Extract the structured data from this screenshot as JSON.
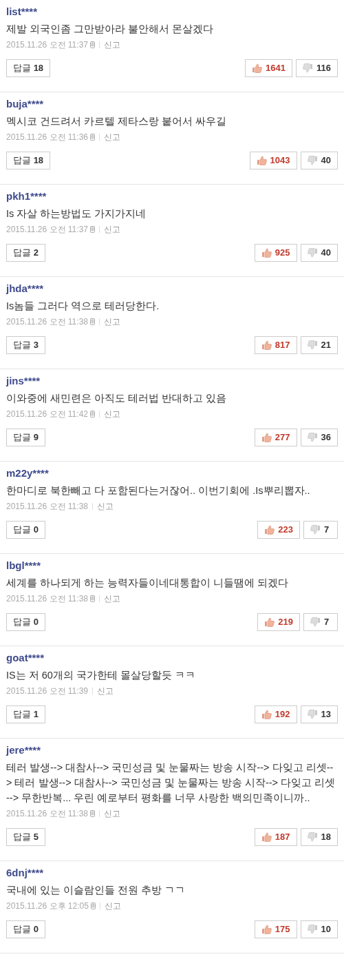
{
  "comments": [
    {
      "user": "list****",
      "text": "제발 외국인좀 그만받아라 불안해서 몬살겠다",
      "date": "2015.11.26 오전 11:37",
      "mobile": true,
      "report": "신고",
      "reply_label": "답글",
      "replies": "18",
      "likes": "1641",
      "dislikes": "116"
    },
    {
      "user": "buja****",
      "text": "멕시코 건드려서 카르텔 제타스랑 붙어서 싸우길",
      "date": "2015.11.26 오전 11:36",
      "mobile": true,
      "report": "신고",
      "reply_label": "답글",
      "replies": "18",
      "likes": "1043",
      "dislikes": "40"
    },
    {
      "user": "pkh1****",
      "text": "Is 자살 하는방법도 가지가지네",
      "date": "2015.11.26 오전 11:37",
      "mobile": true,
      "report": "신고",
      "reply_label": "답글",
      "replies": "2",
      "likes": "925",
      "dislikes": "40"
    },
    {
      "user": "jhda****",
      "text": "Is놈들 그러다 역으로 테러당한다.",
      "date": "2015.11.26 오전 11:38",
      "mobile": true,
      "report": "신고",
      "reply_label": "답글",
      "replies": "3",
      "likes": "817",
      "dislikes": "21"
    },
    {
      "user": "jins****",
      "text": "이와중에 새민련은 아직도 테러법 반대하고 있음",
      "date": "2015.11.26 오전 11:42",
      "mobile": true,
      "report": "신고",
      "reply_label": "답글",
      "replies": "9",
      "likes": "277",
      "dislikes": "36"
    },
    {
      "user": "m22y****",
      "text": "한마디로 북한빼고 다 포함된다는거잖어.. 이번기회에 .Is뿌리뽑자..",
      "date": "2015.11.26 오전 11:38",
      "mobile": false,
      "report": "신고",
      "reply_label": "답글",
      "replies": "0",
      "likes": "223",
      "dislikes": "7"
    },
    {
      "user": "lbgl****",
      "text": "세계를 하나되게 하는 능력자들이네대통합이 니들땜에 되겠다",
      "date": "2015.11.26 오전 11:38",
      "mobile": true,
      "report": "신고",
      "reply_label": "답글",
      "replies": "0",
      "likes": "219",
      "dislikes": "7"
    },
    {
      "user": "goat****",
      "text": "IS는 저 60개의 국가한테 몰살당할듯 ㅋㅋ",
      "date": "2015.11.26 오전 11:39",
      "mobile": false,
      "report": "신고",
      "reply_label": "답글",
      "replies": "1",
      "likes": "192",
      "dislikes": "13"
    },
    {
      "user": "jere****",
      "text": "테러 발생--> 대참사--> 국민성금 및 눈물짜는 방송 시작--> 다잊고 리셋--> 테러 발생--> 대참사--> 국민성금 및 눈물짜는 방송 시작--> 다잊고 리셋 --> 무한반복... 우린 예로부터 평화를 너무 사랑한 백의민족이니까..",
      "date": "2015.11.26 오전 11:38",
      "mobile": true,
      "report": "신고",
      "reply_label": "답글",
      "replies": "5",
      "likes": "187",
      "dislikes": "18"
    },
    {
      "user": "6dnj****",
      "text": "국내에 있는 이슬람인들 전원 추방 ㄱㄱ",
      "date": "2015.11.26 오후 12:05",
      "mobile": true,
      "report": "신고",
      "reply_label": "답글",
      "replies": "0",
      "likes": "175",
      "dislikes": "10"
    }
  ]
}
